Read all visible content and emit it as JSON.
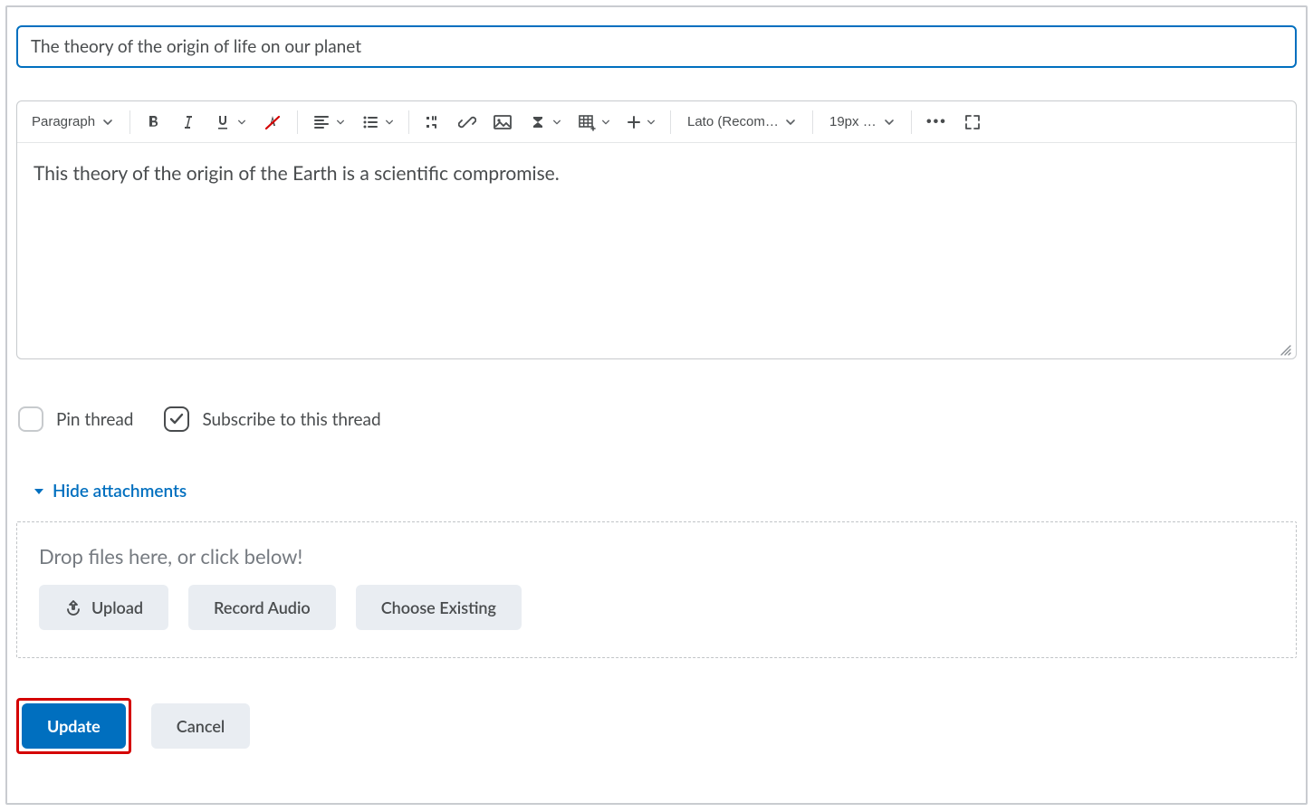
{
  "title_value": "The theory of the origin of life on our planet",
  "toolbar": {
    "paragraph_label": "Paragraph",
    "font_label": "Lato (Recom…",
    "size_label": "19px …"
  },
  "editor_content": "This theory of the origin of the Earth is a scientific compromise.",
  "options": {
    "pin_label": "Pin thread",
    "subscribe_label": "Subscribe to this thread",
    "pin_checked": false,
    "subscribe_checked": true
  },
  "attachments": {
    "toggle_label": "Hide attachments",
    "drop_label": "Drop files here, or click below!",
    "upload_label": "Upload",
    "record_label": "Record Audio",
    "existing_label": "Choose Existing"
  },
  "footer": {
    "update_label": "Update",
    "cancel_label": "Cancel"
  }
}
